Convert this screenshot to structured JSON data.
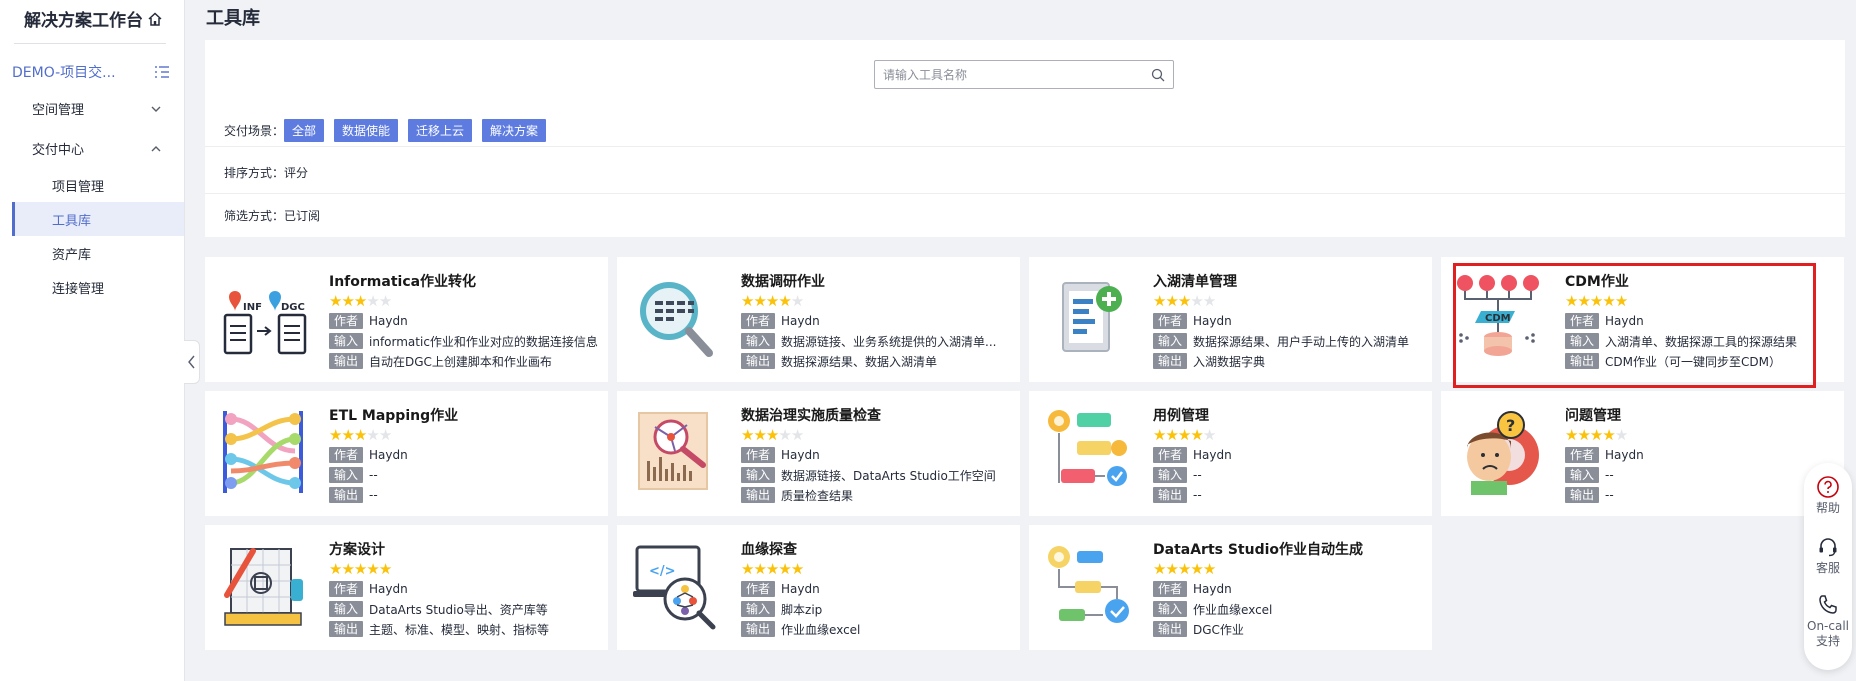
{
  "sidebar": {
    "title": "解决方案工作台",
    "project": "DEMO-项目交...",
    "groups": [
      {
        "label": "空间管理"
      },
      {
        "label": "交付中心"
      }
    ],
    "items": [
      {
        "label": "项目管理"
      },
      {
        "label": "工具库"
      },
      {
        "label": "资产库"
      },
      {
        "label": "连接管理"
      }
    ]
  },
  "page": {
    "title": "工具库"
  },
  "search": {
    "placeholder": "请输入工具名称"
  },
  "filters": {
    "scene_label": "交付场景：",
    "scene_tags": [
      "全部",
      "数据使能",
      "迁移上云",
      "解决方案"
    ],
    "sort_label": "排序方式：",
    "sort_value": "评分",
    "filter_label": "筛选方式：",
    "filter_value": "已订阅"
  },
  "labels": {
    "author": "作者",
    "input": "输入",
    "output": "输出"
  },
  "colors": {
    "accent": "#5e7ce0",
    "star": "#fac20a",
    "highlight": "#e02020"
  },
  "cards": [
    {
      "title": "Informatica作业转化",
      "rating": 3,
      "author": "Haydn",
      "input": "informatic作业和作业对应的数据连接信息",
      "output": "自动在DGC上创建脚本和作业画布",
      "icon": "informatica-convert-icon"
    },
    {
      "title": "数据调研作业",
      "rating": 4,
      "author": "Haydn",
      "input": "数据源链接、业务系统提供的入湖清单...",
      "output": "数据探源结果、数据入湖清单",
      "icon": "data-survey-icon"
    },
    {
      "title": "入湖清单管理",
      "rating": 3,
      "author": "Haydn",
      "input": "数据探源结果、用户手动上传的入湖清单",
      "output": "入湖数据字典",
      "icon": "lake-list-icon"
    },
    {
      "title": "CDM作业",
      "rating": 5,
      "author": "Haydn",
      "input": "入湖清单、数据探源工具的探源结果",
      "output": "CDM作业（可一键同步至CDM）",
      "icon": "cdm-icon",
      "highlighted": true
    },
    {
      "title": "ETL Mapping作业",
      "rating": 3,
      "author": "Haydn",
      "input": "--",
      "output": "--",
      "icon": "etl-mapping-icon"
    },
    {
      "title": "数据治理实施质量检查",
      "rating": 3,
      "author": "Haydn",
      "input": "数据源链接、DataArts Studio工作空间",
      "output": "质量检查结果",
      "icon": "quality-check-icon"
    },
    {
      "title": "用例管理",
      "rating": 4,
      "author": "Haydn",
      "input": "--",
      "output": "--",
      "icon": "usecase-icon"
    },
    {
      "title": "问题管理",
      "rating": 4,
      "author": "Haydn",
      "input": "--",
      "output": "--",
      "icon": "issue-icon"
    },
    {
      "title": "方案设计",
      "rating": 5,
      "author": "Haydn",
      "input": "DataArts Studio导出、资产库等",
      "output": "主题、标准、模型、映射、指标等",
      "icon": "design-icon"
    },
    {
      "title": "血缘探查",
      "rating": 5,
      "author": "Haydn",
      "input": "脚本zip",
      "output": "作业血缘excel",
      "icon": "lineage-icon"
    },
    {
      "title": "DataArts Studio作业自动生成",
      "rating": 5,
      "author": "Haydn",
      "input": "作业血缘excel",
      "output": "DGC作业",
      "icon": "auto-gen-icon"
    }
  ],
  "float_widget": {
    "help": "帮助",
    "service": "客服",
    "oncall_1": "On-call",
    "oncall_2": "支持"
  }
}
